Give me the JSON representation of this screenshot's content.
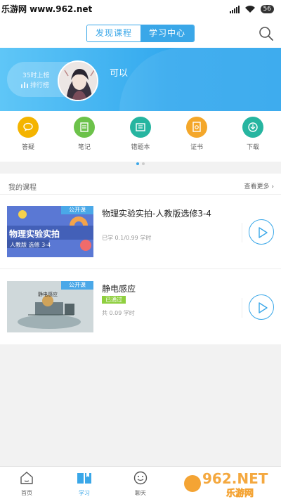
{
  "status_bar": {
    "watermark": "乐游网 www.962.net",
    "battery": "56"
  },
  "header": {
    "tabs": [
      {
        "label": "发现课程",
        "active": false
      },
      {
        "label": "学习中心",
        "active": true
      }
    ],
    "accent_color": "#3aa7e8"
  },
  "profile": {
    "study_time": "35时上榜",
    "rank_label": "排行榜",
    "username": "可以"
  },
  "shortcuts": [
    {
      "label": "答疑",
      "icon": "chat-bubble-icon",
      "color": "#f4b400"
    },
    {
      "label": "笔记",
      "icon": "note-icon",
      "color": "#6cc24a"
    },
    {
      "label": "错题本",
      "icon": "wrong-book-icon",
      "color": "#26b5a0"
    },
    {
      "label": "证书",
      "icon": "certificate-icon",
      "color": "#f4a72a"
    },
    {
      "label": "下载",
      "icon": "download-icon",
      "color": "#26b5a0"
    }
  ],
  "my_courses": {
    "title": "我的课程",
    "see_more": "查看更多",
    "items": [
      {
        "tag": "公开课",
        "title": "物理实验实拍-人教版选修3-4",
        "progress": "已学 0.1/0.99 学时",
        "badge": "",
        "thumb_text": "物理实验实拍",
        "thumb_sub": "人教版 选修 3-4"
      },
      {
        "tag": "公开课",
        "title": "静电感应",
        "progress": "共 0.09 学时",
        "badge": "已通过",
        "thumb_text": "静电感应",
        "thumb_sub": ""
      }
    ]
  },
  "tab_bar": {
    "tabs": [
      {
        "label": "首页",
        "icon": "home-icon",
        "active": false
      },
      {
        "label": "学习",
        "icon": "book-icon",
        "active": true
      },
      {
        "label": "聊天",
        "icon": "smile-chat-icon",
        "active": false
      }
    ]
  },
  "watermark_bottom": {
    "brand": "962.NET",
    "sub": "乐游网"
  }
}
